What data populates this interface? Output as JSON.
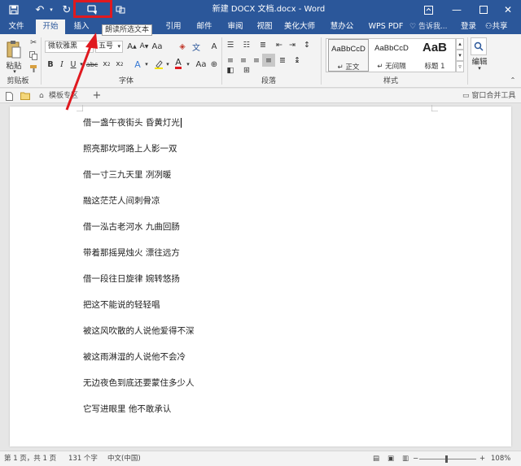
{
  "window": {
    "title": "新建 DOCX 文档.docx - Word",
    "tooltip": "朗读所选文本",
    "accent_color": "#2b579a",
    "highlight_color": "#e0191f"
  },
  "tabs": [
    {
      "label": "文件"
    },
    {
      "label": "开始"
    },
    {
      "label": "插入"
    },
    {
      "label": "引用"
    },
    {
      "label": "邮件"
    },
    {
      "label": "审阅"
    },
    {
      "label": "视图"
    },
    {
      "label": "美化大师"
    },
    {
      "label": "慧办公"
    },
    {
      "label": "WPS PDF"
    }
  ],
  "tellme": "告诉我...",
  "login": "登录",
  "share": "共享",
  "ribbon": {
    "paste_label": "粘贴",
    "clipboard_group": "剪贴板",
    "font_name": "微软雅黑",
    "font_size": "五号",
    "font_group": "字体",
    "paragraph_group": "段落",
    "styles_group": "样式",
    "edit_label": "编辑",
    "styles": [
      {
        "preview": "AaBbCcD",
        "name": "↵ 正文"
      },
      {
        "preview": "AaBbCcD",
        "name": "↵ 无间隔"
      },
      {
        "preview": "AaB",
        "name": "标题 1"
      }
    ]
  },
  "doc_tabs": {
    "template_tab": "模板专区",
    "merge_window": "窗口合并工具"
  },
  "document": {
    "lines": [
      "借一盏午夜街头  昏黄灯光",
      "照亮那坎坷路上人影一双",
      "借一寸三九天里  冽冽暖",
      "融这茫茫人间刺骨凉",
      "借一泓古老河水  九曲回肠",
      "带着那摇晃烛火  漂往远方",
      "借一段往日旋律  婉转悠扬",
      "把这不能说的轻轻唱",
      "被这风吹散的人说他爱得不深",
      "被这雨淋湿的人说他不会冷",
      "无边夜色到底还要蒙住多少人",
      "它写进眼里  他不敢承认"
    ]
  },
  "status": {
    "page": "第 1 页，共 1 页",
    "words": "131 个字",
    "language": "中文(中国)",
    "zoom": "108%"
  }
}
